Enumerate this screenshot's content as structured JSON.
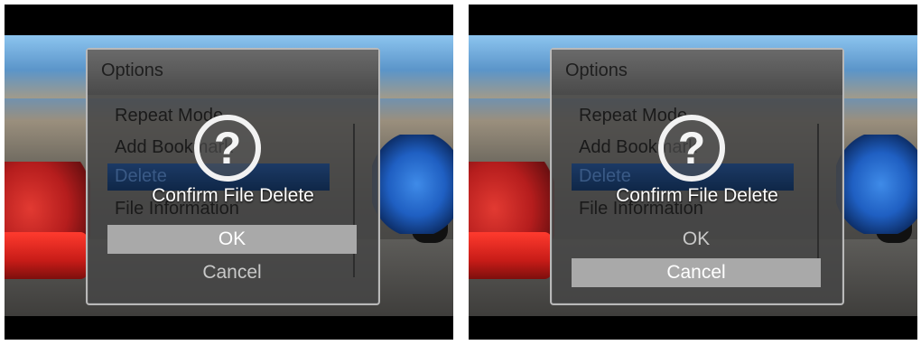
{
  "screens": [
    {
      "options": {
        "title": "Options",
        "items": [
          "Repeat Mode",
          "Add Bookmark",
          "Delete",
          "File Information"
        ]
      },
      "dialog": {
        "icon": "question-icon",
        "message": "Confirm File Delete",
        "ok_label": "OK",
        "cancel_label": "Cancel",
        "selected": "OK"
      }
    },
    {
      "options": {
        "title": "Options",
        "items": [
          "Repeat Mode",
          "Add Bookmark",
          "Delete",
          "File Information"
        ]
      },
      "dialog": {
        "icon": "question-icon",
        "message": "Confirm File Delete",
        "ok_label": "OK",
        "cancel_label": "Cancel",
        "selected": "Cancel"
      }
    }
  ],
  "colors": {
    "highlight": "#1c3a66",
    "selected_button": "#a9a9a9",
    "panel_border": "#b9b9b9"
  }
}
